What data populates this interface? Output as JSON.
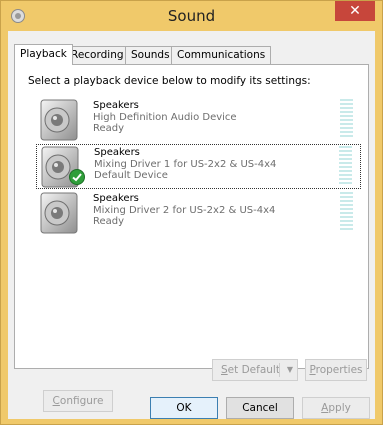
{
  "window": {
    "title": "Sound",
    "close_glyph": "✕",
    "accent_color": "#f0c96a",
    "close_color": "#c7463b"
  },
  "tabs": [
    {
      "label": "Playback",
      "active": true
    },
    {
      "label": "Recording",
      "active": false
    },
    {
      "label": "Sounds",
      "active": false
    },
    {
      "label": "Communications",
      "active": false
    }
  ],
  "playback": {
    "instruction": "Select a playback device below to modify its settings:",
    "devices": [
      {
        "name": "Speakers",
        "description": "High Definition Audio Device",
        "status": "Ready",
        "is_default": false,
        "selected": false
      },
      {
        "name": "Speakers",
        "description": "Mixing Driver 1 for US-2x2 & US-4x4",
        "status": "Default Device",
        "is_default": true,
        "selected": true
      },
      {
        "name": "Speakers",
        "description": "Mixing Driver 2 for US-2x2 & US-4x4",
        "status": "Ready",
        "is_default": false,
        "selected": false
      }
    ],
    "buttons": {
      "configure": {
        "mnemonic": "C",
        "rest": "onfigure"
      },
      "set_default": {
        "mnemonic": "S",
        "rest": "et Default",
        "arrow": "▼"
      },
      "properties": {
        "mnemonic": "P",
        "rest": "roperties"
      }
    }
  },
  "footer": {
    "ok": "OK",
    "cancel": "Cancel",
    "apply": {
      "mnemonic": "A",
      "rest": "pply"
    }
  },
  "icons": {
    "app": "speaker-icon",
    "device": "speaker-icon",
    "default_badge": "checkmark-icon",
    "meter": "level-meter-icon"
  }
}
